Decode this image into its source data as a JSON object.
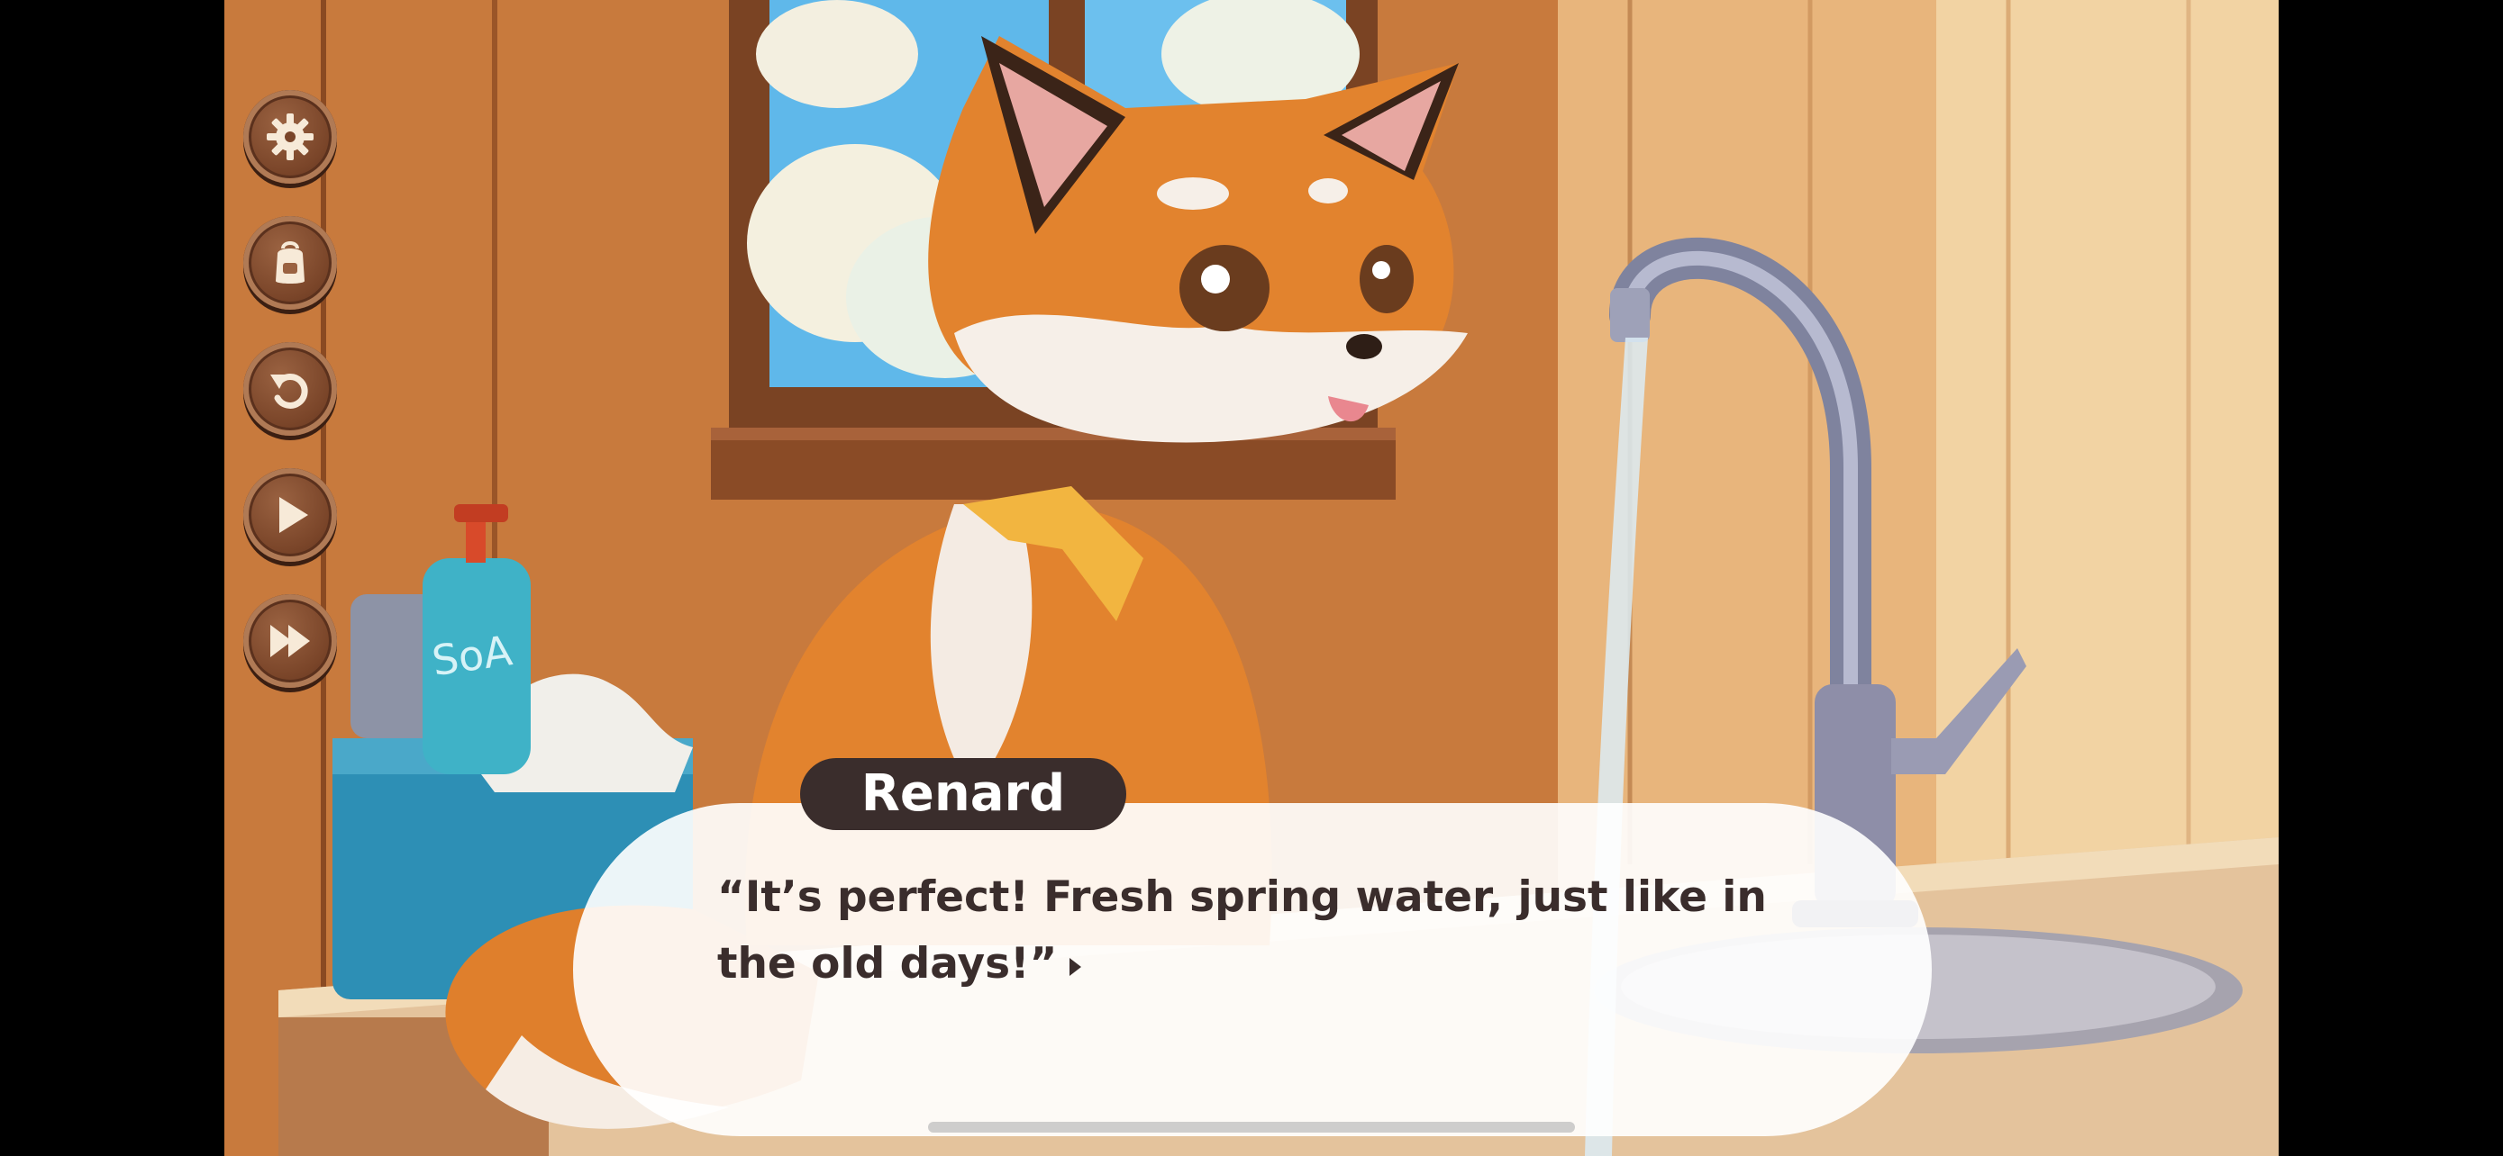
{
  "dialogue": {
    "speaker": "Renard",
    "line": "“It’s perfect! Fresh spring water, just like in the old days!”"
  },
  "menu": {
    "items": [
      {
        "icon": "gear-icon"
      },
      {
        "icon": "backpack-icon"
      },
      {
        "icon": "undo-icon"
      },
      {
        "icon": "play-icon"
      },
      {
        "icon": "fast-forward-icon"
      }
    ]
  },
  "scene": {
    "soap_label": "SoA"
  },
  "colors": {
    "name_plate": "#3a2d2c",
    "dialog_bg": "#ffffff",
    "menu_button": "#7a4529",
    "fox_orange": "#e2832e"
  }
}
